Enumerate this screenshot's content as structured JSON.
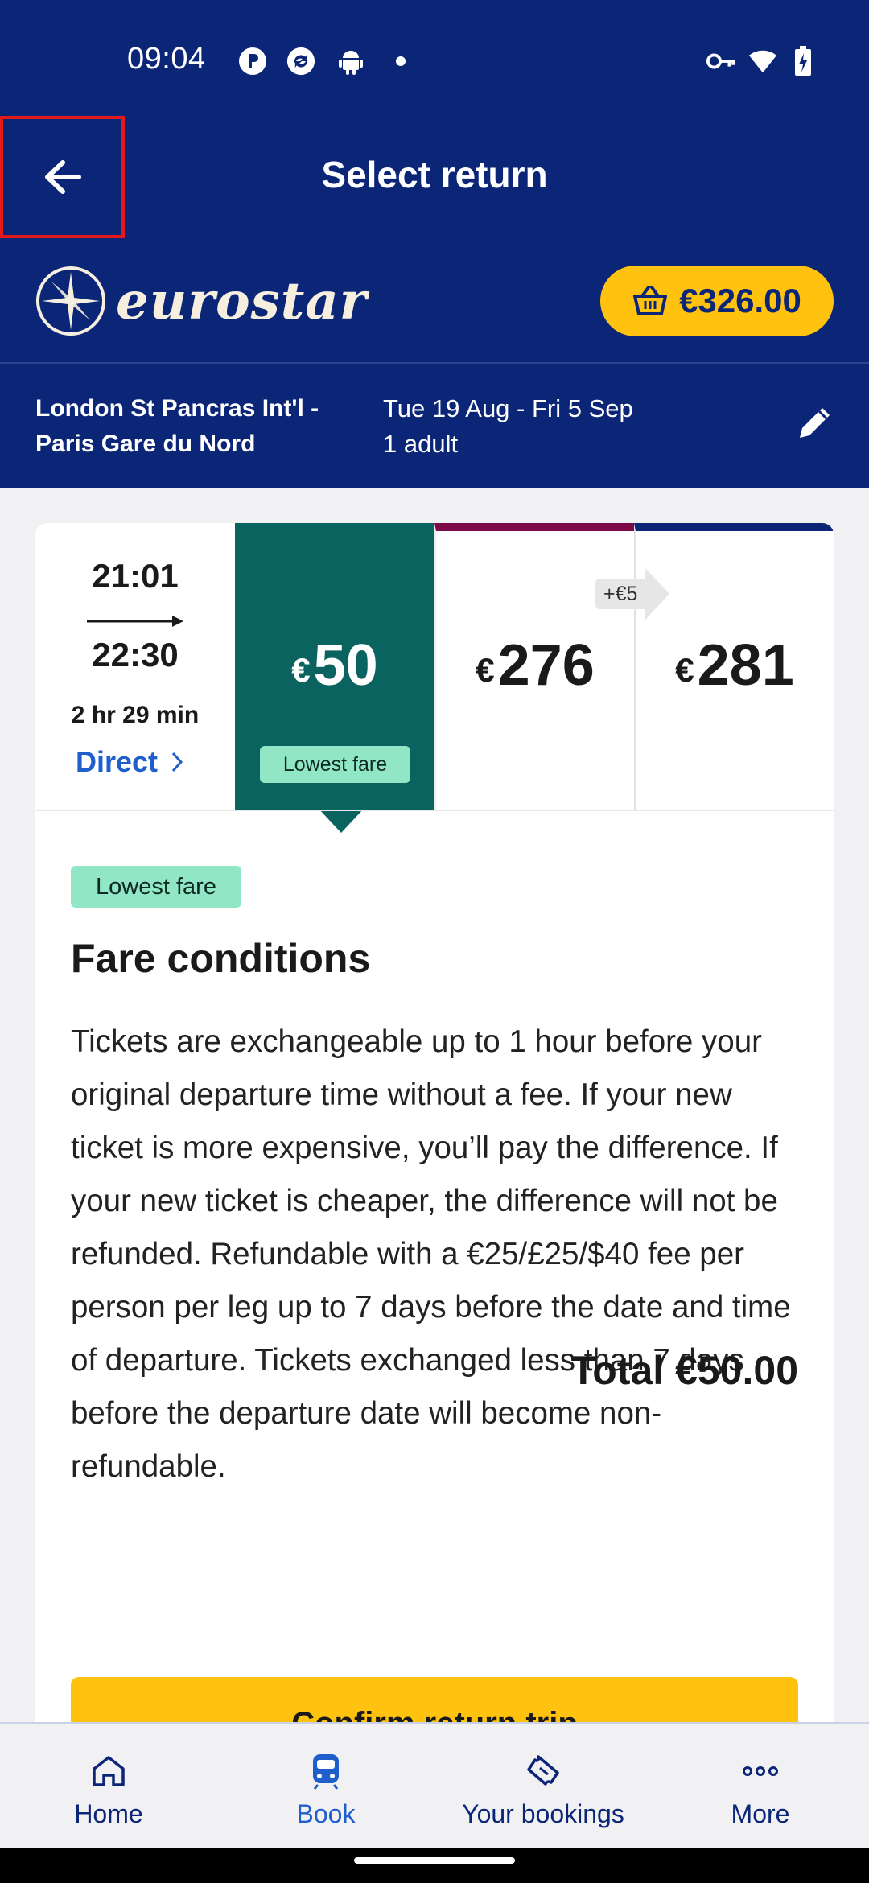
{
  "status": {
    "time": "09:04"
  },
  "header": {
    "title": "Select return"
  },
  "brand": {
    "name": "eurostar"
  },
  "basket": {
    "amount": "€326.00"
  },
  "journey": {
    "route_line1": "London St Pancras Int'l -",
    "route_line2": "Paris Gare du Nord",
    "dates": "Tue 19 Aug - Fri 5 Sep",
    "passengers": "1 adult"
  },
  "train": {
    "departure": "21:01",
    "arrival": "22:30",
    "duration": "2 hr 29 min",
    "type": "Direct"
  },
  "fares": [
    {
      "currency": "€",
      "amount": "50",
      "badge": "Lowest fare",
      "selected": true,
      "color": "#0b6360"
    },
    {
      "currency": "€",
      "amount": "276",
      "color": "#7c0a49"
    },
    {
      "currency": "€",
      "amount": "281",
      "color": "#0b2577"
    }
  ],
  "fare_diff": "+€5",
  "conditions": {
    "badge": "Lowest fare",
    "title": "Fare conditions",
    "text": "Tickets are exchangeable up to 1 hour before your original departure time without a fee. If your new ticket is more expensive, you’ll pay the difference. If your new ticket is cheaper, the difference will not be refunded. Refundable with a €25/£25/$40 fee per person per leg up to 7 days before the date and time of departure. Tickets exchanged less than 7 days before the departure date will become non-refundable.",
    "total": "Total €50.00",
    "confirm_label": "Confirm return trip"
  },
  "nav": [
    {
      "label": "Home",
      "icon": "home-icon"
    },
    {
      "label": "Book",
      "icon": "train-icon",
      "active": true
    },
    {
      "label": "Your bookings",
      "icon": "ticket-icon"
    },
    {
      "label": "More",
      "icon": "more-icon"
    }
  ],
  "colors": {
    "brand_blue": "#0b2577",
    "accent_yellow": "#ffc20e",
    "teal": "#0b6360",
    "badge_green": "#91e6c6",
    "link_blue": "#1f5fcc"
  }
}
